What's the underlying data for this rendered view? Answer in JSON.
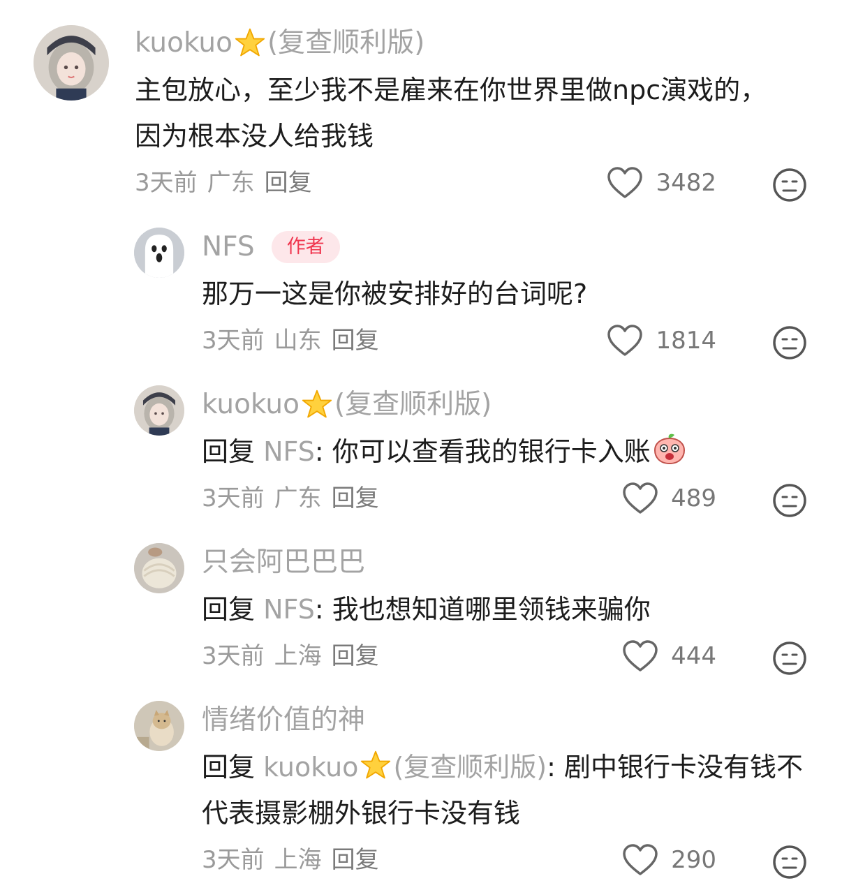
{
  "comments": [
    {
      "username": "kuokuo",
      "name_suffix": "(复查顺利版)",
      "author_badge": "",
      "reply_prefix": "",
      "reply_target": "",
      "text": "主包放心，至少我不是雇来在你世界里做npc演戏的，因为根本没人给我钱",
      "text_line2": "",
      "time": "3天前",
      "location": "广东",
      "reply_label": "回复",
      "likes": "3482"
    },
    {
      "username": "NFS",
      "name_suffix": "",
      "author_badge": "作者",
      "reply_prefix": "",
      "reply_target": "",
      "text": "那万一这是你被安排好的台词呢?",
      "time": "3天前",
      "location": "山东",
      "reply_label": "回复",
      "likes": "1814"
    },
    {
      "username": "kuokuo",
      "name_suffix": "(复查顺利版)",
      "author_badge": "",
      "reply_prefix": "回复 ",
      "reply_target": "NFS",
      "text": ": 你可以查看我的银行卡入账",
      "time": "3天前",
      "location": "广东",
      "reply_label": "回复",
      "likes": "489"
    },
    {
      "username": "只会阿巴巴巴",
      "name_suffix": "",
      "author_badge": "",
      "reply_prefix": "回复 ",
      "reply_target": "NFS",
      "text": ": 我也想知道哪里领钱来骗你",
      "time": "3天前",
      "location": "上海",
      "reply_label": "回复",
      "likes": "444"
    },
    {
      "username": "情绪价值的神",
      "name_suffix": "",
      "author_badge": "",
      "reply_prefix": "回复 ",
      "reply_target": "kuokuo",
      "reply_target_suffix": "(复查顺利版)",
      "text": ": 剧中银行卡没有钱不代表摄影棚外银行卡没有钱",
      "time": "3天前",
      "location": "上海",
      "reply_label": "回复",
      "likes": "290"
    }
  ],
  "colors": {
    "name_gray": "#a3a3a3",
    "badge_bg": "#fde7ea",
    "badge_text": "#f0364f"
  },
  "icons": {
    "like": "heart-outline-icon",
    "dislike": "meh-face-icon",
    "star": "star-emoji-icon",
    "emoji": "surprised-peach-emoji"
  }
}
